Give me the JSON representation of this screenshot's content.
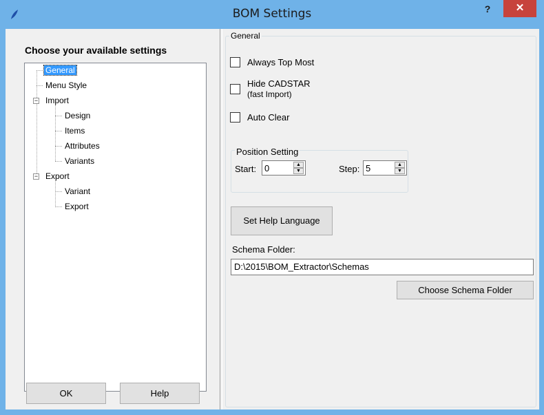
{
  "window": {
    "title": "BOM Settings",
    "help_glyph": "?",
    "close_glyph": "✕",
    "app_icon": "feather-icon",
    "accent": "#6fb2e8",
    "close_color": "#c7433c"
  },
  "left": {
    "heading": "Choose your available settings",
    "tree": [
      {
        "label": "General",
        "selected": true
      },
      {
        "label": "Menu Style"
      },
      {
        "label": "Import",
        "expander": "−"
      },
      {
        "label": "Design"
      },
      {
        "label": "Items"
      },
      {
        "label": "Attributes"
      },
      {
        "label": "Variants"
      },
      {
        "label": "Export",
        "expander": "−"
      },
      {
        "label": "Variant"
      },
      {
        "label": "Export"
      }
    ],
    "ok_label": "OK",
    "help_label": "Help"
  },
  "right": {
    "group_title": "General",
    "always_top_most": {
      "label": "Always Top Most",
      "checked": false
    },
    "hide_cadstar": {
      "label_line1": "Hide CADSTAR",
      "label_line2": "(fast Import)",
      "checked": false
    },
    "auto_clear": {
      "label": "Auto Clear",
      "checked": false
    },
    "position": {
      "title": "Position Setting",
      "start_label": "Start:",
      "start_value": "0",
      "step_label": "Step:",
      "step_value": "5"
    },
    "set_help_language_label": "Set Help Language",
    "schema_label": "Schema Folder:",
    "schema_value": "D:\\2015\\BOM_Extractor\\Schemas",
    "choose_schema_label": "Choose Schema Folder"
  }
}
